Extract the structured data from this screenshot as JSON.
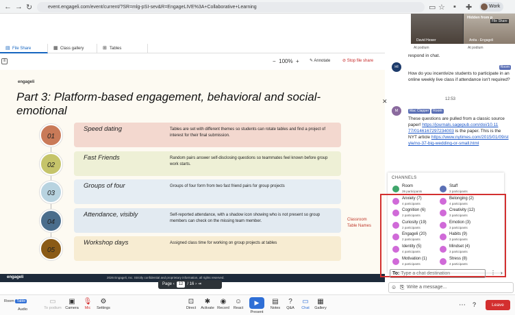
{
  "browser": {
    "url": "event.engageli.com/event/current/?SR=mlg-pSI-sev&R=EngageLIVE%3A+Collaborative+Learning",
    "profile": "Work"
  },
  "video": {
    "hidden_label": "Hidden from p",
    "file_share": "File Share",
    "tiles": [
      {
        "name": "David Hewer",
        "status": "At podium"
      },
      {
        "name": "Anita - Engageli",
        "status": "At podium"
      }
    ]
  },
  "tabs": [
    {
      "label": "File Share"
    },
    {
      "label": "Class gallery"
    },
    {
      "label": "Tables"
    }
  ],
  "toolbar": {
    "zoom": "100%",
    "annotate": "Annotate",
    "stop_share": "Stop file share"
  },
  "slide": {
    "logo": "engageli",
    "title": "Part 3: Platform-based engagement, behavioral and social-emotional",
    "rows": [
      {
        "num": "01",
        "title": "Speed dating",
        "desc": "Tables are set with different themes so students can rotate tables and find a project of interest for their final submission.",
        "color": "#f3d8cf",
        "circle": "#c97a58"
      },
      {
        "num": "02",
        "title": "Fast Friends",
        "desc": "Random pairs answer self-disclosing questions so teammates feel known before group work starts.",
        "color": "#eef0d6",
        "circle": "#c5c46a"
      },
      {
        "num": "03",
        "title": "Groups of four",
        "desc": "Groups of four form from two fast friend pairs for group projects",
        "color": "#e5edf3",
        "circle": "#b8d3e0"
      },
      {
        "num": "04",
        "title": "Attendance, visibly",
        "desc": "Self-reported attendance, with a shadow icon showing who is not present so group members can check on the missing team member.",
        "color": "#e2eaf1",
        "circle": "#4a6d8c"
      },
      {
        "num": "05",
        "title": "Workshop days",
        "desc": "Assigned class time for working on group projects at tables",
        "color": "#f7ecd2",
        "circle": "#8a5a16"
      }
    ],
    "side_note_line1": "Classroom",
    "side_note_line2": "Table Names",
    "footer_logo": "engageli",
    "footer_copy": "2026 Engageli, Inc. Strictly confidential and proprietary information, all rights reserved."
  },
  "pager": {
    "label": "Page",
    "current": "12",
    "total": "/ 16"
  },
  "chat": {
    "partial": "respond in chat.",
    "msg1": {
      "initials": "HI",
      "badge": "Room",
      "text": "How do you incentivize students to participate in an online weekly live class if attendance isn't required?"
    },
    "time": "12:53",
    "msg2": {
      "initials": "M",
      "name": "Mac Clapper",
      "badge": "Room",
      "text": "These questions are pulled from a classic source paper!",
      "link1": "https://journals.sagepub.com/doi/10.11 77/0146167297234003",
      "mid": " is the paper. This is the NYT article",
      "link2": "https://www.nytimes.com/2015/01/09/st yle/no-37-big-wedding-or-small.html"
    }
  },
  "channels": {
    "heading": "CHANNELS",
    "items": [
      {
        "name": "Room",
        "parts": "39 participants",
        "type": "g"
      },
      {
        "name": "Staff",
        "parts": "3 participants",
        "type": "b"
      },
      {
        "name": "Anxiety (7)",
        "parts": "4 participants"
      },
      {
        "name": "Belonging (2)",
        "parts": "4 participants"
      },
      {
        "name": "Cognition (6)",
        "parts": "2 participants"
      },
      {
        "name": "Creativity (12)",
        "parts": "3 participants"
      },
      {
        "name": "Curiosity (19)",
        "parts": "2 participants"
      },
      {
        "name": "Emotion (3)",
        "parts": "3 participants"
      },
      {
        "name": "Engageli (20)",
        "parts": "2 participants"
      },
      {
        "name": "Habits (9)",
        "parts": "3 participants"
      },
      {
        "name": "Identity (5)",
        "parts": "4 participants"
      },
      {
        "name": "Mindset (4)",
        "parts": "3 participants"
      },
      {
        "name": "Motivation (1)",
        "parts": "4 participants"
      },
      {
        "name": "Stress (8)",
        "parts": "4 participants"
      }
    ]
  },
  "input": {
    "to_label": "To:",
    "to_placeholder": "Type a chat destination",
    "message_placeholder": "Write a message..."
  },
  "bottom": {
    "room": "Room",
    "table": "Table",
    "audio": "Audio",
    "to_podium": "To podium",
    "camera": "Camera",
    "mic": "Mic",
    "settings": "Settings",
    "direct": "Direct",
    "activate": "Activate",
    "record": "Record",
    "react": "React",
    "present": "Present",
    "notes": "Notes",
    "qa": "Q&A",
    "chat": "Chat",
    "gallery": "Gallery",
    "leave": "Leave"
  }
}
